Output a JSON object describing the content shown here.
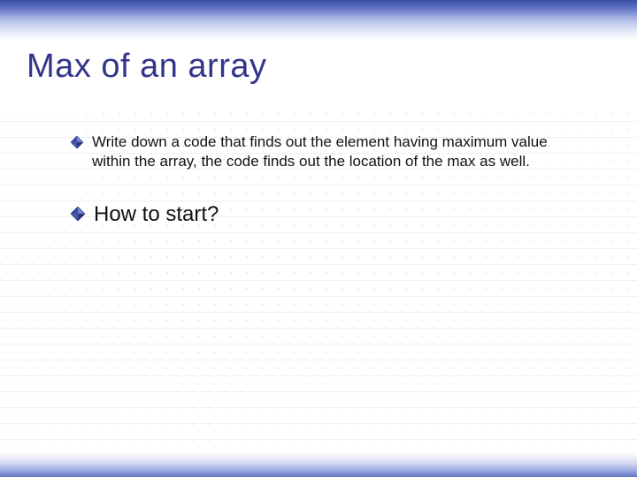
{
  "slide": {
    "title": "Max of an array",
    "bullets": [
      {
        "text": "Write down a code that finds out the element having maximum value within the array, the code finds out the location of the max as well.",
        "size": "small"
      },
      {
        "text": "How to start?",
        "size": "large"
      }
    ]
  }
}
